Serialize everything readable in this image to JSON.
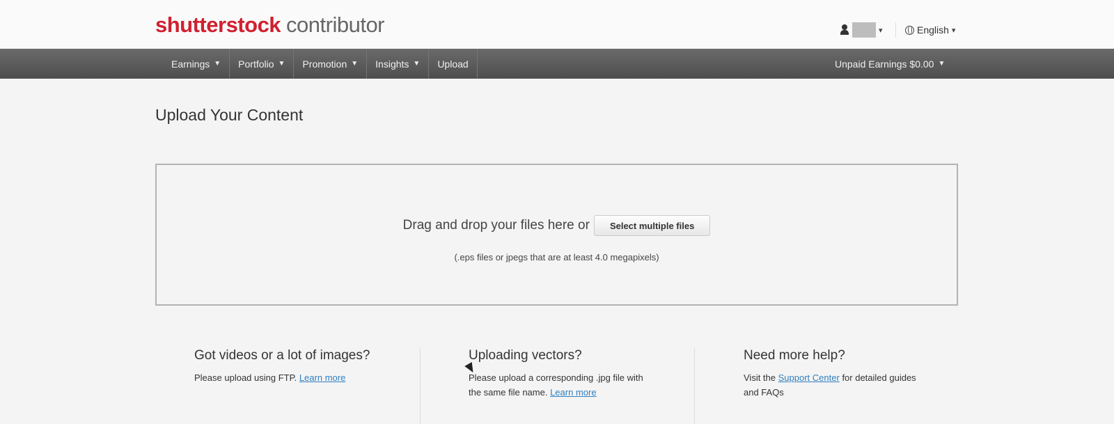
{
  "header": {
    "brand": "shutterstock",
    "product": "contributor",
    "language": "English"
  },
  "nav": {
    "items": [
      {
        "label": "Earnings",
        "dropdown": true
      },
      {
        "label": "Portfolio",
        "dropdown": true
      },
      {
        "label": "Promotion",
        "dropdown": true
      },
      {
        "label": "Insights",
        "dropdown": true
      },
      {
        "label": "Upload",
        "dropdown": false
      }
    ],
    "earnings_label": "Unpaid Earnings",
    "earnings_value": "$0.00"
  },
  "main": {
    "title": "Upload Your Content",
    "dropzone": {
      "text": "Drag and drop your files here or",
      "button_label": "Select multiple files",
      "note": "(.eps files or jpegs that are at least 4.0 megapixels)"
    }
  },
  "help": {
    "ftp": {
      "title": "Got videos or a lot of images?",
      "text": "Please upload using FTP.",
      "link": "Learn more"
    },
    "vectors": {
      "title": "Uploading vectors?",
      "text": "Please upload a corresponding .jpg file with the same file name.",
      "link": "Learn more"
    },
    "support": {
      "title": "Need more help?",
      "text_before": "Visit the",
      "link": "Support Center",
      "text_after": "for detailed guides and FAQs"
    }
  },
  "colors": {
    "brand_red": "#d0202f",
    "nav_bg": "#555555",
    "link": "#2f7fbf"
  }
}
